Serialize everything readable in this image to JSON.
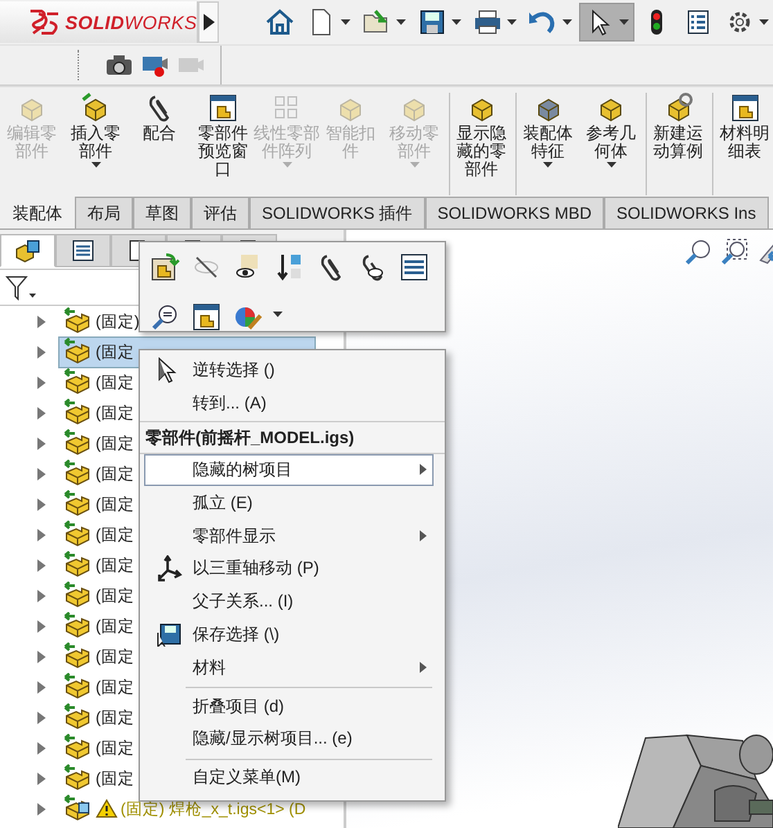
{
  "logo": {
    "text": "**SOLID**WORKS"
  },
  "toolbar": [
    {
      "selected": false,
      "dropdown": false
    },
    {
      "selected": false,
      "dropdown": true
    },
    {
      "selected": false,
      "dropdown": true
    },
    {
      "selected": false,
      "dropdown": true
    },
    {
      "selected": false,
      "dropdown": true
    },
    {
      "selected": false,
      "dropdown": true
    },
    {
      "selected": true,
      "dropdown": true
    },
    {
      "selected": false,
      "dropdown": false
    },
    {
      "selected": false,
      "dropdown": false
    },
    {
      "selected": false,
      "dropdown": true
    }
  ],
  "ribbon": [
    {
      "label": "编辑零部件",
      "disabled": true,
      "dropdown": false,
      "separator_before": false
    },
    {
      "label": "插入零部件",
      "disabled": false,
      "dropdown": true,
      "separator_before": false
    },
    {
      "label": "配合",
      "disabled": false,
      "dropdown": false,
      "separator_before": false
    },
    {
      "label": "零部件预览窗口",
      "disabled": false,
      "dropdown": false,
      "separator_before": false
    },
    {
      "label": "线性零部件阵列",
      "disabled": true,
      "dropdown": true,
      "separator_before": false
    },
    {
      "label": "智能扣件",
      "disabled": true,
      "dropdown": false,
      "separator_before": false
    },
    {
      "label": "移动零部件",
      "disabled": true,
      "dropdown": true,
      "separator_before": false
    },
    {
      "label": "显示隐藏的零部件",
      "disabled": false,
      "dropdown": false,
      "separator_before": true
    },
    {
      "label": "装配体特征",
      "disabled": false,
      "dropdown": true,
      "separator_before": true
    },
    {
      "label": "参考几何体",
      "disabled": false,
      "dropdown": true,
      "separator_before": false
    },
    {
      "label": "新建运动算例",
      "disabled": false,
      "dropdown": false,
      "separator_before": true
    },
    {
      "label": "材料明细表",
      "disabled": false,
      "dropdown": false,
      "separator_before": true
    }
  ],
  "tabs": [
    {
      "label": "装配体",
      "selected": true
    },
    {
      "label": "布局",
      "selected": false
    },
    {
      "label": "草图",
      "selected": false
    },
    {
      "label": "评估",
      "selected": false
    },
    {
      "label": "SOLIDWORKS 插件",
      "selected": false
    },
    {
      "label": "SOLIDWORKS MBD",
      "selected": false
    },
    {
      "label": "SOLIDWORKS Ins",
      "selected": false
    }
  ],
  "panel_tabs": [
    {
      "selected": true
    },
    {
      "selected": false
    },
    {
      "selected": false
    },
    {
      "selected": false
    },
    {
      "selected": false
    }
  ],
  "tree": [
    {
      "text": "(固定)",
      "selected": false,
      "warning": false
    },
    {
      "text": "(固定",
      "selected": true,
      "warning": false
    },
    {
      "text": "(固定",
      "selected": false,
      "warning": false
    },
    {
      "text": "(固定",
      "selected": false,
      "warning": false
    },
    {
      "text": "(固定",
      "selected": false,
      "warning": false
    },
    {
      "text": "(固定",
      "selected": false,
      "warning": false
    },
    {
      "text": "(固定",
      "selected": false,
      "warning": false
    },
    {
      "text": "(固定",
      "selected": false,
      "warning": false
    },
    {
      "text": "(固定",
      "selected": false,
      "warning": false
    },
    {
      "text": "(固定",
      "selected": false,
      "warning": false
    },
    {
      "text": "(固定",
      "selected": false,
      "warning": false
    },
    {
      "text": "(固定",
      "selected": false,
      "warning": false
    },
    {
      "text": "(固定",
      "selected": false,
      "warning": false
    },
    {
      "text": "(固定",
      "selected": false,
      "warning": false
    },
    {
      "text": "(固定",
      "selected": false,
      "warning": false
    },
    {
      "text": "(固定",
      "selected": false,
      "warning": false
    },
    {
      "text": "(固定) 焊枪_x_t.igs<1> (D",
      "selected": false,
      "warning": true
    }
  ],
  "context_menu": [
    {
      "kind": "item",
      "label": "逆转选择 ()",
      "submenu": false,
      "selected": false,
      "separator_before": false
    },
    {
      "kind": "item",
      "label": "转到... (A)",
      "submenu": false,
      "selected": false,
      "separator_before": false
    },
    {
      "kind": "header",
      "label": "零部件(前摇杆_MODEL.igs)"
    },
    {
      "kind": "item",
      "label": "隐藏的树项目",
      "submenu": true,
      "selected": true,
      "separator_before": false
    },
    {
      "kind": "item",
      "label": "孤立 (E)",
      "submenu": false,
      "selected": false,
      "separator_before": false
    },
    {
      "kind": "item",
      "label": "零部件显示",
      "submenu": true,
      "selected": false,
      "separator_before": false
    },
    {
      "kind": "item",
      "label": "以三重轴移动 (P)",
      "submenu": false,
      "selected": false,
      "separator_before": false
    },
    {
      "kind": "item",
      "label": "父子关系... (I)",
      "submenu": false,
      "selected": false,
      "separator_before": false
    },
    {
      "kind": "item",
      "label": "保存选择 (\\)",
      "submenu": false,
      "selected": false,
      "separator_before": false
    },
    {
      "kind": "item",
      "label": "材料",
      "submenu": true,
      "selected": false,
      "separator_before": false
    },
    {
      "kind": "item",
      "label": "折叠项目 (d)",
      "submenu": false,
      "selected": false,
      "separator_before": true
    },
    {
      "kind": "item",
      "label": "隐藏/显示树项目... (e)",
      "submenu": false,
      "selected": false,
      "separator_before": false
    },
    {
      "kind": "item",
      "label": "自定义菜单(M)",
      "submenu": false,
      "selected": false,
      "separator_before": true
    }
  ]
}
